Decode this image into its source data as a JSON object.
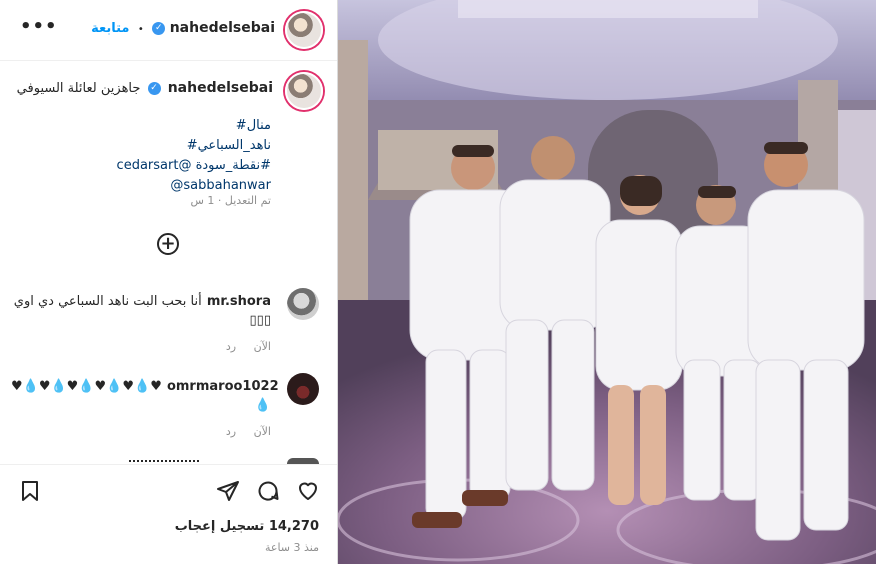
{
  "post": {
    "username": "nahedelsebai",
    "follow_label": "متابعة",
    "separator": "•",
    "more_label": "•••",
    "caption": "جاهزين لعائلة السيوفي",
    "tags": [
      "#منال",
      "#ناهد_السباعي",
      "#نقطة_سودة @cedarsart",
      "@sabbahanwar"
    ],
    "edited": "تم التعديل · 1 س"
  },
  "comments": [
    {
      "user": "mr.shora",
      "text": "أنا بحب البت ناهد السباعي دي اوي",
      "extra": "▯▯▯",
      "time": "الآن",
      "reply": "رد"
    },
    {
      "user": "omrmaroo1022",
      "text": "♥💧♥💧♥💧♥💧♥💧♥",
      "extra": "💧",
      "time": "الآن",
      "reply": "رد"
    }
  ],
  "footer": {
    "likes_count": "14,270",
    "likes_label": "تسجيل إعجاب",
    "time": "منذ 3 ساعة"
  },
  "colors": {
    "accent": "#0095f6",
    "verified": "#3897f0",
    "link": "#00376b"
  }
}
